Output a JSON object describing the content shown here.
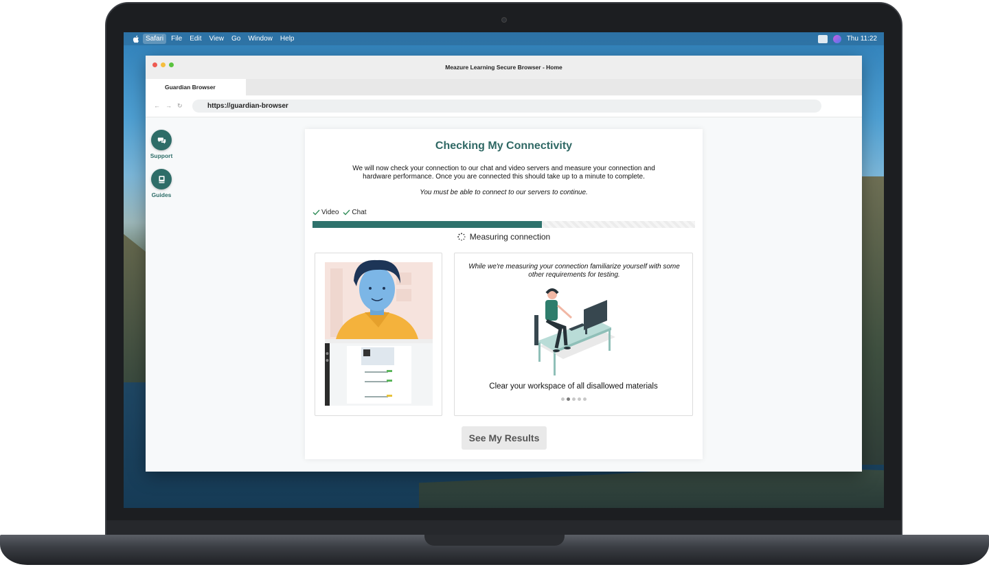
{
  "menubar": {
    "items": [
      "Safari",
      "File",
      "Edit",
      "View",
      "Go",
      "Window",
      "Help"
    ],
    "clock": "Thu 11:22"
  },
  "window": {
    "title": "Meazure Learning Secure Browser - Home",
    "tab_label": "Guardian Browser",
    "url": "https://guardian-browser"
  },
  "sidebar": {
    "support_label": "Support",
    "guides_label": "Guides"
  },
  "card": {
    "title": "Checking My Connectivity",
    "description": "We will now check your connection to our chat and video servers and measure your connection and hardware performance. Once you are connected this should take up to a minute to complete.",
    "note": "You must be able to connect to our servers to continue.",
    "checks": [
      "Video",
      "Chat"
    ],
    "progress": 0.6,
    "status": "Measuring connection",
    "info_caption": "While we're measuring  your connection familiarize yourself with some other requirements for testing.",
    "slide_caption": "Clear your workspace of all disallowed materials",
    "slide_count": 5,
    "slide_active": 2,
    "results_button": "See My Results"
  },
  "colors": {
    "brand": "#2e6d68",
    "progress": "#2e726c"
  }
}
